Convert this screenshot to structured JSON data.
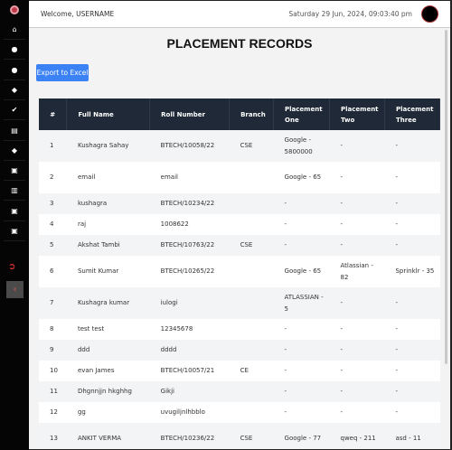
{
  "header": {
    "welcome": "Welcome, USERNAME",
    "datetime": "Saturday 29 Jun, 2024, 09:03:40 pm"
  },
  "title": "PLACEMENT RECORDS",
  "export_label": "Export to Excel",
  "sidebar": {
    "icons": [
      "home-icon",
      "user-icon",
      "user-icon",
      "graduation-cap-icon",
      "check-circle-icon",
      "document-icon",
      "graduation-cap-icon",
      "briefcase-icon",
      "chalkboard-icon",
      "briefcase-icon",
      "briefcase-icon"
    ]
  },
  "table": {
    "headers": [
      "#",
      "Full Name",
      "Roll Number",
      "Branch",
      "Placement One",
      "Placement Two",
      "Placement Three"
    ],
    "rows": [
      [
        "1",
        "Kushagra Sahay",
        "BTECH/10058/22",
        "CSE",
        "Google - 5800000",
        "-",
        "-"
      ],
      [
        "2",
        "email",
        "email",
        "",
        "Google - 65",
        "-",
        "-"
      ],
      [
        "3",
        "kushagra",
        "BTECH/10234/22",
        "",
        "-",
        "-",
        "-"
      ],
      [
        "4",
        "raj",
        "1008622",
        "",
        "-",
        "-",
        "-"
      ],
      [
        "5",
        "Akshat Tambi",
        "BTECH/10763/22",
        "CSE",
        "-",
        "-",
        "-"
      ],
      [
        "6",
        "Sumit Kumar",
        "BTECH/10265/22",
        "",
        "Google - 65",
        "Atlassian - 82",
        "Sprinklr - 35"
      ],
      [
        "7",
        "Kushagra kumar",
        "iulogi",
        "",
        "ATLASSIAN - 5",
        "-",
        "-"
      ],
      [
        "8",
        "test test",
        "12345678",
        "",
        "-",
        "-",
        "-"
      ],
      [
        "9",
        "ddd",
        "dddd",
        "",
        "-",
        "-",
        "-"
      ],
      [
        "10",
        "evan James",
        "BTECH/10057/21",
        "CE",
        "-",
        "-",
        "-"
      ],
      [
        "11",
        "Dhgnnjjn hkghhg",
        "Gikji",
        "",
        "-",
        "-",
        "-"
      ],
      [
        "12",
        "gg",
        "uvugiljnlhbblo",
        "",
        "-",
        "-",
        "-"
      ],
      [
        "13",
        "ANKIT VERMA",
        "BTECH/10236/22",
        "CSE",
        "Google - 77",
        "qweq - 211",
        "asd - 11"
      ]
    ]
  }
}
